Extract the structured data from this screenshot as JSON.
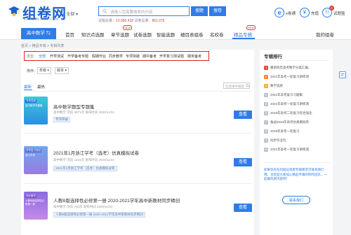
{
  "header": {
    "logo_text": "组卷网",
    "logo_url": "ZUJUAN.XKW.COM",
    "location": "全部",
    "search_placeholder": "请输入您需要搜索的内容",
    "search_button": "搜题",
    "search_button2": "搜卷",
    "stats_prefix": "试题总量：",
    "stats_questions": "13,580,418",
    "stats_mid": "试卷总量：",
    "stats_papers": "861,075",
    "right_items": [
      {
        "label": "e卷通",
        "icon": "e-book-icon"
      },
      {
        "label": "充值",
        "icon": "yuan-icon"
      },
      {
        "label": "试题篮",
        "icon": "basket-icon",
        "badge": "0"
      }
    ]
  },
  "nav": {
    "subject": "高中数学",
    "items": [
      "首页",
      "知识点选题",
      "章节选题",
      "试卷选题",
      "智能选题",
      "细目表组卷",
      "名校卷",
      "精品专辑"
    ],
    "new_label": "NEW",
    "my_label": "我的组卷"
  },
  "breadcrumb": "首页 > 精品专辑 > 专辑列表",
  "filter": {
    "label": "类型：",
    "options": [
      "全部",
      "开学测试",
      "开学备考专题",
      "假期作业",
      "同步教学",
      "专项突破",
      "期中备考",
      "开学复习测试题",
      "期末备考"
    ]
  },
  "sort": {
    "label": "排序：",
    "grade_value": "年级",
    "version_value": "版本"
  },
  "tabs": [
    "最新",
    "最热"
  ],
  "list_search_placeholder": "在结果中搜索",
  "items": [
    {
      "thumb_label": "专项突破",
      "thumb_sub": "高中数学专题集",
      "title": "高中数学题型专题集",
      "meta": "高中数学  浏览 3871次  发布时间 2020/11/24",
      "tag": "专项突破",
      "view": "查看"
    },
    {
      "thumb_label": "开学复习测试",
      "thumb_sub": "浙江学考",
      "title": "2021年1月浙江学考（选考）仿真模拟试卷",
      "meta": "高中数学  浏览 1216次  发布时间 2020/11/24",
      "tag": "2021年1月浙江学考（选考）仿真模拟试卷",
      "view": "查看"
    },
    {
      "thumb_label": "同步教学",
      "thumb_sub": "人教B版选择性必修第一册",
      "title": "人教B版选择性必修第一册 2020-2021学年高中新教材同步精创",
      "meta": "高中数学  浏览 763次  发布时间 2020/11/24",
      "tag": "人教B版选择性必修第一册 2020-2021学年高中新教材同步精创",
      "view": "查看"
    }
  ],
  "sidebar": {
    "title": "专辑排行",
    "items": [
      "最新四年高考数学分类汇编...",
      "2021年高考一轮复习讲练测",
      "数学选修",
      "2021年高考复习习题集",
      "2021年高考一轮复习讲练测",
      "2019年高考二轮复习综合强化",
      "备战2020年高考仿真模拟卷",
      "2019年高考一轮复习",
      "同步作业包",
      "2021年高考一轮复习讲练测"
    ],
    "promo": "如果您有任何疑议或者专辑需求可联系我们哦，也欢迎大家加入精品专辑的制作团队，一起做优质内容吧！",
    "contact": "联系我们"
  }
}
